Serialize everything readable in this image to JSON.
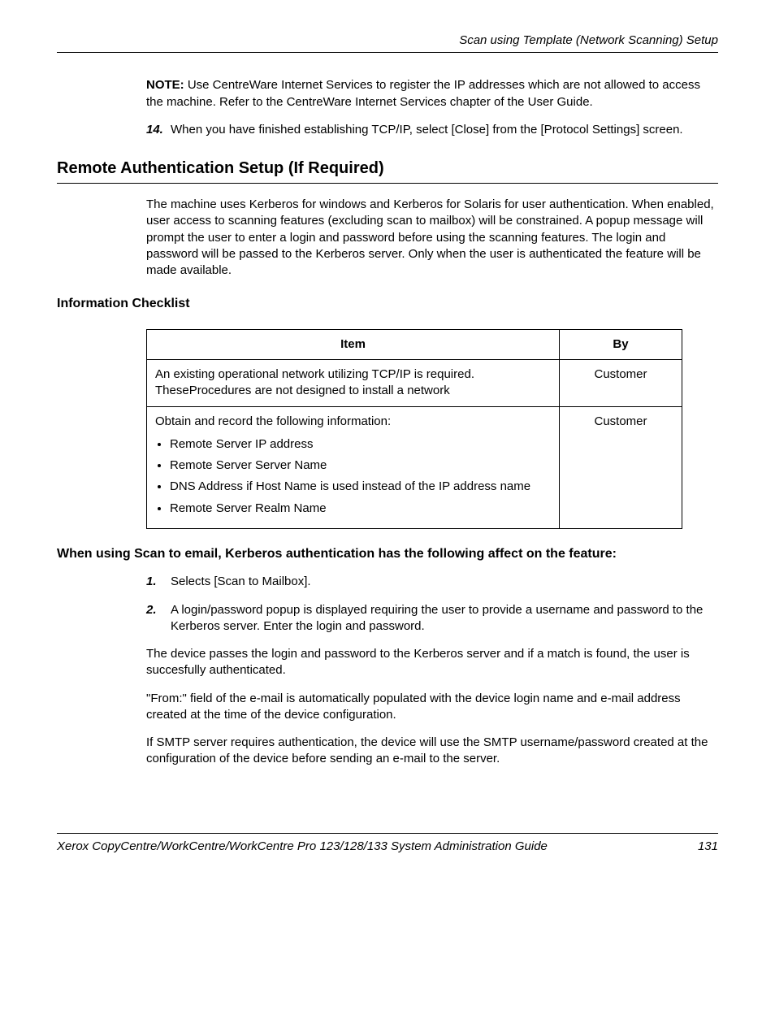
{
  "running_head": "Scan using Template (Network Scanning) Setup",
  "note": {
    "label": "NOTE:",
    "text": " Use CentreWare Internet Services to register the IP addresses which are not allowed to access the machine. Refer to the CentreWare Internet Services chapter of the User Guide."
  },
  "step14": {
    "num": "14.",
    "text": "When you have finished establishing TCP/IP, select [Close] from the [Protocol Settings] screen."
  },
  "section_title": "Remote Authentication Setup (If Required)",
  "section_intro": "The machine uses Kerberos for windows and Kerberos for Solaris for user authentication. When enabled, user access to scanning features (excluding scan to mailbox) will be constrained. A popup message will prompt the user to enter a login and password before using the scanning features. The login and password will be passed to the Kerberos server. Only when the user is authenticated the feature will be made available.",
  "checklist_heading": "Information Checklist",
  "table": {
    "header_item": "Item",
    "header_by": "By",
    "row1": {
      "item": "An existing operational network utilizing TCP/IP is required. TheseProcedures are not designed to install a network",
      "by": "Customer"
    },
    "row2": {
      "intro": "Obtain and record the following information:",
      "bullets": [
        "Remote Server IP address",
        "Remote Server Server Name",
        "DNS Address if Host Name is used instead of the IP address name",
        "Remote Server Realm Name"
      ],
      "by": "Customer"
    }
  },
  "effect_heading": "When using Scan to email, Kerberos authentication has the following affect on the feature:",
  "effect_steps": [
    {
      "num": "1.",
      "text": "Selects [Scan to Mailbox]."
    },
    {
      "num": "2.",
      "text": "A login/password popup is displayed requiring the user to provide a username and password to the Kerberos server. Enter the login and password."
    }
  ],
  "effect_paras": [
    "The device passes the login and password to the Kerberos server and if a match is found, the user is succesfully authenticated.",
    "\"From:\" field of the e-mail is automatically populated with the device login name and e-mail address created at the time of the device configuration.",
    "If SMTP server requires authentication, the device will use the SMTP username/password created at the configuration of the device before sending an e-mail to the server."
  ],
  "footer": {
    "title": "Xerox CopyCentre/WorkCentre/WorkCentre Pro 123/128/133 System Administration Guide",
    "page": "131"
  }
}
